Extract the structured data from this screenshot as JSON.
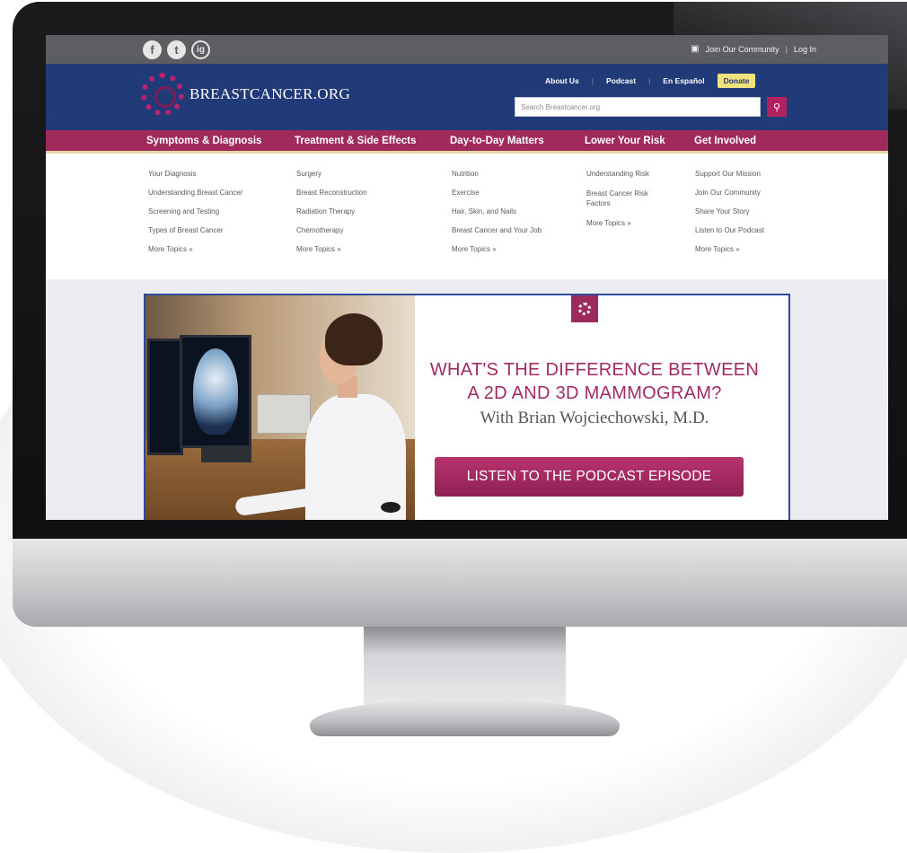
{
  "topbar": {
    "social": [
      {
        "icon": "facebook-icon",
        "glyph": "f"
      },
      {
        "icon": "twitter-icon",
        "glyph": "t"
      },
      {
        "icon": "instagram-icon",
        "glyph": "ig"
      }
    ],
    "join_label": "Join Our Community",
    "login_label": "Log In"
  },
  "header": {
    "logo_text": "BREASTCANCER.ORG",
    "util_links": [
      "About Us",
      "Podcast",
      "En Español"
    ],
    "donate_label": "Donate",
    "search_placeholder": "Search Breastcancer.org"
  },
  "mainnav": [
    "Symptoms & Diagnosis",
    "Treatment & Side Effects",
    "Day-to-Day Matters",
    "Lower Your Risk",
    "Get Involved"
  ],
  "mega": [
    [
      "Your Diagnosis",
      "Understanding Breast Cancer",
      "Screening and Testing",
      "Types of Breast Cancer",
      "More Topics »"
    ],
    [
      "Surgery",
      "Breast Reconstruction",
      "Radiation Therapy",
      "Chemotherapy",
      "More Topics »"
    ],
    [
      "Nutrition",
      "Exercise",
      "Hair, Skin, and Nails",
      "Breast Cancer and Your Job",
      "More Topics »"
    ],
    [
      "Understanding Risk",
      "Breast Cancer Risk Factors",
      "More Topics »"
    ],
    [
      "Support Our Mission",
      "Join Our Community",
      "Share Your Story",
      "Listen to Our Podcast",
      "More Topics »"
    ]
  ],
  "banner": {
    "headline_line1": "WHAT'S THE DIFFERENCE BETWEEN",
    "headline_line2": "A 2D AND 3D MAMMOGRAM?",
    "byline": "With Brian Wojciechowski, M.D.",
    "cta_label": "LISTEN TO THE PODCAST EPISODE"
  },
  "colors": {
    "navy": "#213a78",
    "magenta": "#a12a5c",
    "donate": "#f2e27b",
    "topbar": "#5d5e61"
  }
}
